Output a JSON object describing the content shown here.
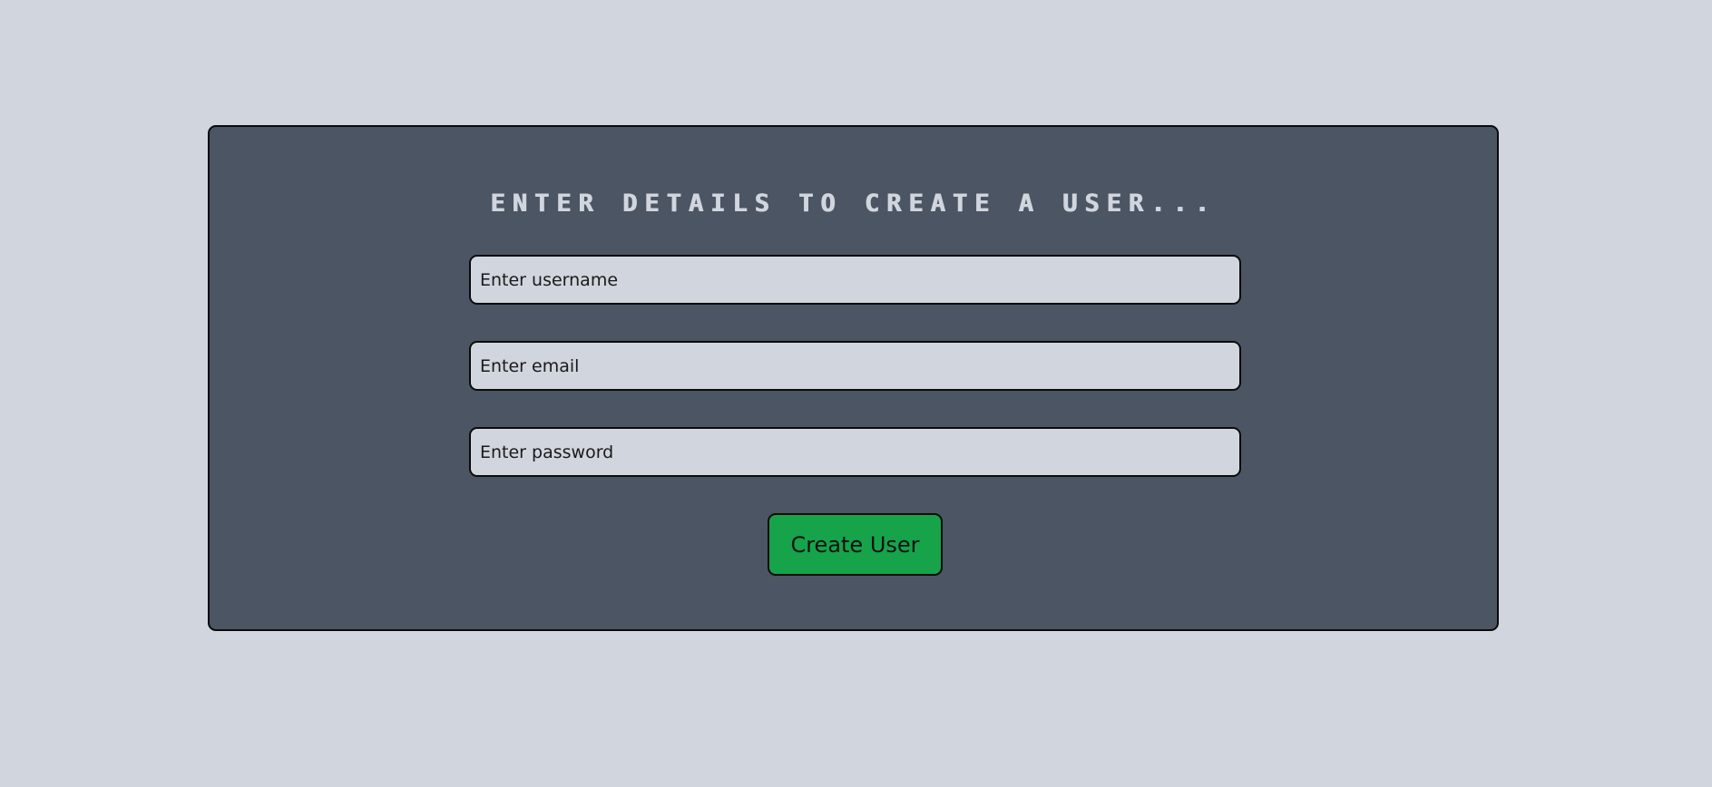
{
  "colors": {
    "page_background": "#d1d5de",
    "card_background": "#4b5563",
    "title_text": "#d1d5de",
    "input_background": "#d1d5de",
    "button_background": "#16a34a",
    "border": "#0b0b0b"
  },
  "form": {
    "title": "ENTER DETAILS TO CREATE A USER...",
    "username": {
      "value": "",
      "placeholder": "Enter username"
    },
    "email": {
      "value": "",
      "placeholder": "Enter email"
    },
    "password": {
      "value": "",
      "placeholder": "Enter password"
    },
    "submit_label": "Create User"
  }
}
